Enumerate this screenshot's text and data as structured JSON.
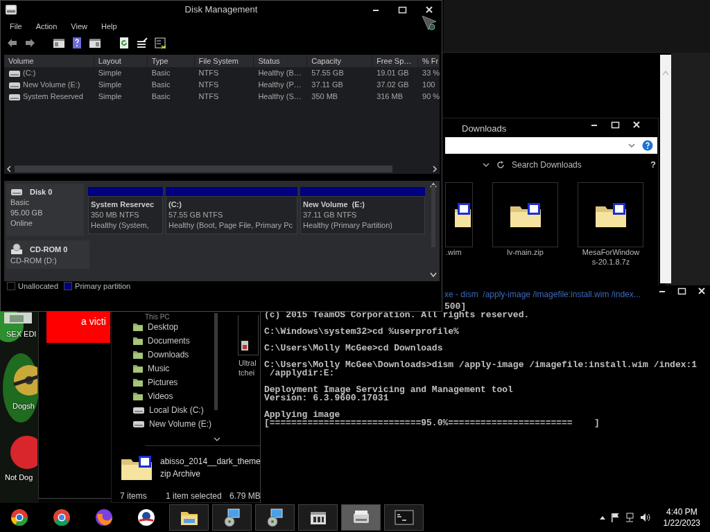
{
  "disk_management": {
    "title": "Disk Management",
    "menu": [
      "File",
      "Action",
      "View",
      "Help"
    ],
    "table": {
      "columns": [
        "Volume",
        "Layout",
        "Type",
        "File System",
        "Status",
        "Capacity",
        "Free Sp…",
        "% Fr"
      ],
      "rows": [
        [
          "(C:)",
          "Simple",
          "Basic",
          "NTFS",
          "Healthy (B…",
          "57.55 GB",
          "19.01 GB",
          "33 %"
        ],
        [
          "New Volume (E:)",
          "Simple",
          "Basic",
          "NTFS",
          "Healthy (P…",
          "37.11 GB",
          "37.02 GB",
          "100"
        ],
        [
          "System Reserved",
          "Simple",
          "Basic",
          "NTFS",
          "Healthy (S…",
          "350 MB",
          "316 MB",
          "90 %"
        ]
      ]
    },
    "disks": [
      {
        "name": "Disk 0",
        "kind": "hdd",
        "lines": [
          "Basic",
          "95.00 GB",
          "Online"
        ],
        "partitions": [
          {
            "name": "System Reservec",
            "size": "350 MB NTFS",
            "status": "Healthy (System,",
            "color": "#000080"
          },
          {
            "name": "(C:)",
            "size": "57.55 GB NTFS",
            "status": "Healthy (Boot, Page File, Primary Pc",
            "color": "#000080"
          },
          {
            "name": "New Volume  (E:)",
            "size": "37.11 GB NTFS",
            "status": "Healthy (Primary Partition)",
            "color": "#000080"
          }
        ]
      },
      {
        "name": "CD-ROM 0",
        "kind": "cdrom",
        "lines": [
          "CD-ROM (D:)"
        ]
      }
    ],
    "legend": [
      {
        "label": "Unallocated",
        "color": "#000000"
      },
      {
        "label": "Primary partition",
        "color": "#000080"
      }
    ]
  },
  "desktop": {
    "icons": [
      {
        "label": "SEX EDI"
      },
      {
        "label": "Dogsh"
      },
      {
        "label": "Not Dog"
      }
    ],
    "banner": "a victi"
  },
  "explorer": {
    "title": "Downloads",
    "search": {
      "placeholder": "Search Downloads"
    },
    "help": "?",
    "files": [
      {
        "lines": [
          ".wim"
        ]
      },
      {
        "lines": [
          "lv-main.zip"
        ]
      },
      {
        "lines": [
          "MesaForWindow",
          "s-20.1.8.7z"
        ]
      }
    ],
    "partial_tile": [
      "Ultral",
      "tchei"
    ],
    "nav": [
      {
        "label": "This PC",
        "kind": "pc"
      },
      {
        "label": "Desktop",
        "kind": "folder"
      },
      {
        "label": "Documents",
        "kind": "folder"
      },
      {
        "label": "Downloads",
        "kind": "folder"
      },
      {
        "label": "Music",
        "kind": "folder"
      },
      {
        "label": "Pictures",
        "kind": "folder"
      },
      {
        "label": "Videos",
        "kind": "folder"
      },
      {
        "label": "Local Disk (C:)",
        "kind": "drive"
      },
      {
        "label": "New Volume (E:)",
        "kind": "drive"
      }
    ],
    "details": {
      "name": "abisso_2014__dark_theme",
      "type": "zip Archive"
    },
    "status": {
      "count": "7 items",
      "selection": "1 item selected",
      "size": "6.79 MB"
    }
  },
  "console": {
    "title": "xe - dism  /apply-image /imagefile:install.wim /index...",
    "partial_line": "500]",
    "blocks": [
      [
        "(c) 2015 TeamOS Corporation. All rights reserved."
      ],
      [
        "C:\\Windows\\system32>cd %userprofile%"
      ],
      [
        "C:\\Users\\Molly McGee>cd Downloads"
      ],
      [
        "C:\\Users\\Molly McGee\\Downloads>dism /apply-image /imagefile:install.wim /index:1",
        " /applydir:E:"
      ],
      [
        "Deployment Image Servicing and Management tool",
        "Version: 6.3.9600.17031"
      ],
      [
        "Applying image",
        "[============================95.0%=======================    ]"
      ]
    ]
  },
  "taskbar": {
    "items": [
      {
        "kind": "pinned",
        "selected": false
      },
      {
        "kind": "pinned",
        "selected": false
      },
      {
        "kind": "pinned",
        "selected": false
      },
      {
        "kind": "pinned",
        "selected": false
      },
      {
        "kind": "window",
        "selected": false
      },
      {
        "kind": "window",
        "selected": false
      },
      {
        "kind": "window",
        "selected": false
      },
      {
        "kind": "window",
        "selected": false
      },
      {
        "kind": "window",
        "selected": true
      },
      {
        "kind": "window",
        "selected": false
      }
    ],
    "time": "4:40 PM",
    "date": "1/22/2023"
  }
}
